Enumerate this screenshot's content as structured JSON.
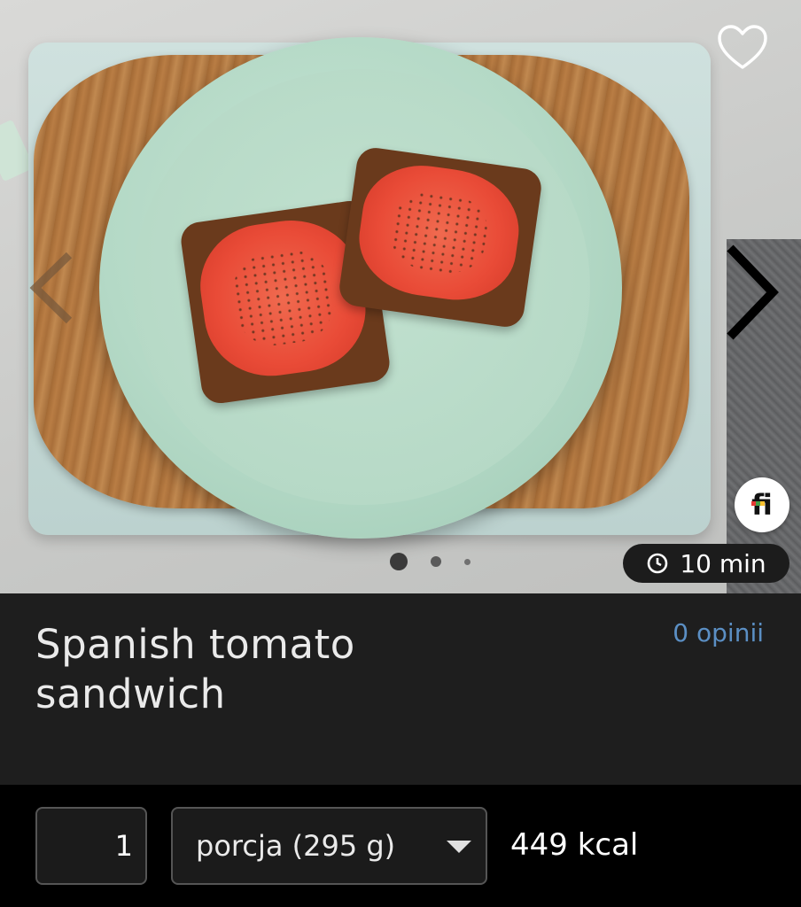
{
  "hero": {
    "favorite_icon": "heart-outline-icon",
    "prev_icon": "chevron-left-icon",
    "next_icon": "chevron-right-icon",
    "badge_icon": "fi-logo-icon",
    "badge_text": "fi",
    "carousel": {
      "total": 3,
      "active": 1
    },
    "time": {
      "icon": "clock-icon",
      "label": "10 min"
    }
  },
  "recipe": {
    "title": "Spanish tomato sandwich",
    "reviews_label": "0 opinii"
  },
  "serving": {
    "quantity": "1",
    "unit_label": "porcja (295 g)",
    "dropdown_icon": "caret-down-icon",
    "kcal_label": "449 kcal"
  },
  "colors": {
    "background": "#000000",
    "info_panel": "#1e1e1e",
    "reviews_link": "#5b8fc4",
    "text": "#eaeaea"
  }
}
